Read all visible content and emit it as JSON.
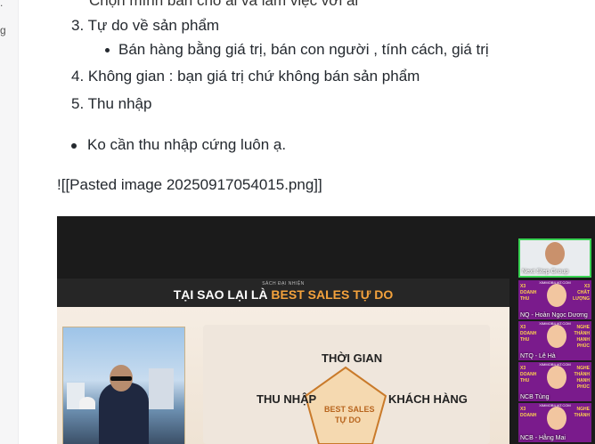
{
  "sidebar": {
    "fragments": [
      ".",
      "g"
    ]
  },
  "document": {
    "cut_line": "Chọn mình bán cho ai và làm việc với ai",
    "ordered_items": [
      {
        "number": "3.",
        "text": "Tự do về sản phẩm"
      },
      {
        "number": "4.",
        "text": "Không gian : bạn giá trị chứ không bán sản phẩm"
      },
      {
        "number": "5.",
        "text": "Thu nhập"
      }
    ],
    "sub_bullet": "Bán hàng bằng giá trị, bán con người , tính cách, giá trị",
    "bullet": "Ko cần thu nhập cứng luôn ạ.",
    "embed_link": "![[Pasted image 20250917054015.png]]"
  },
  "embedded_image": {
    "slide": {
      "kicker": "SÁCH ĐẠI NHIỆN",
      "title_prefix": "TẠI SAO LẠI LÀ ",
      "title_highlight": "BEST SALES TỰ DO",
      "diagram": {
        "top": "THỜI GIAN",
        "left": "THU NHẬP",
        "right": "KHÁCH HÀNG",
        "center_line1": "BEST SALES",
        "center_line2": "TỰ DO"
      }
    },
    "participants": [
      {
        "name": "Next Step Group",
        "active": true
      },
      {
        "name": "NQ - Hoàn Ngọc Dương",
        "active": false,
        "left": "X3\nDOANH\nTHU",
        "right": "X3\nCHẤT\nLƯỢNG"
      },
      {
        "name": "NTQ - Lê Hà",
        "active": false,
        "left": "X3\nDOANH\nTHU",
        "right": "NGHE\nTHÀNH\nHẠNH\nPHÚC"
      },
      {
        "name": "NCB Tùng",
        "active": false,
        "left": "X3\nDOANH\nTHU",
        "right": "NGHE\nTHÀNH\nHẠNH\nPHÚC"
      },
      {
        "name": "NCB - Hằng Mai",
        "active": false,
        "left": "X3\nDOANH",
        "right": "NGHE\nTHÀNH"
      }
    ],
    "participant_brand": "XIMMOBILIAT.COM"
  },
  "colors": {
    "accent": "#f4a23c",
    "tile_bg": "#7a1b8c",
    "active_border": "#39d353"
  }
}
